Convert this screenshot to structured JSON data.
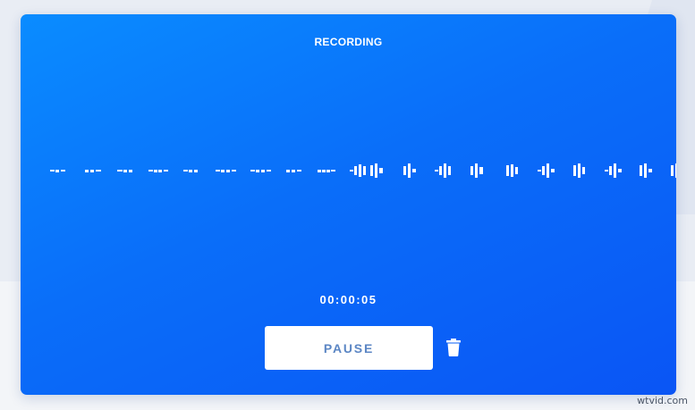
{
  "recorder": {
    "title": "RECORDING",
    "elapsed_time": "00:00:05",
    "pause_label": "PAUSE",
    "delete_icon": "trash-icon"
  },
  "colors": {
    "panel_top": "#0a8cff",
    "panel_bottom": "#0a55f5",
    "button_text": "#5b86c4",
    "white": "#ffffff"
  },
  "watermark": "wtvid.com"
}
